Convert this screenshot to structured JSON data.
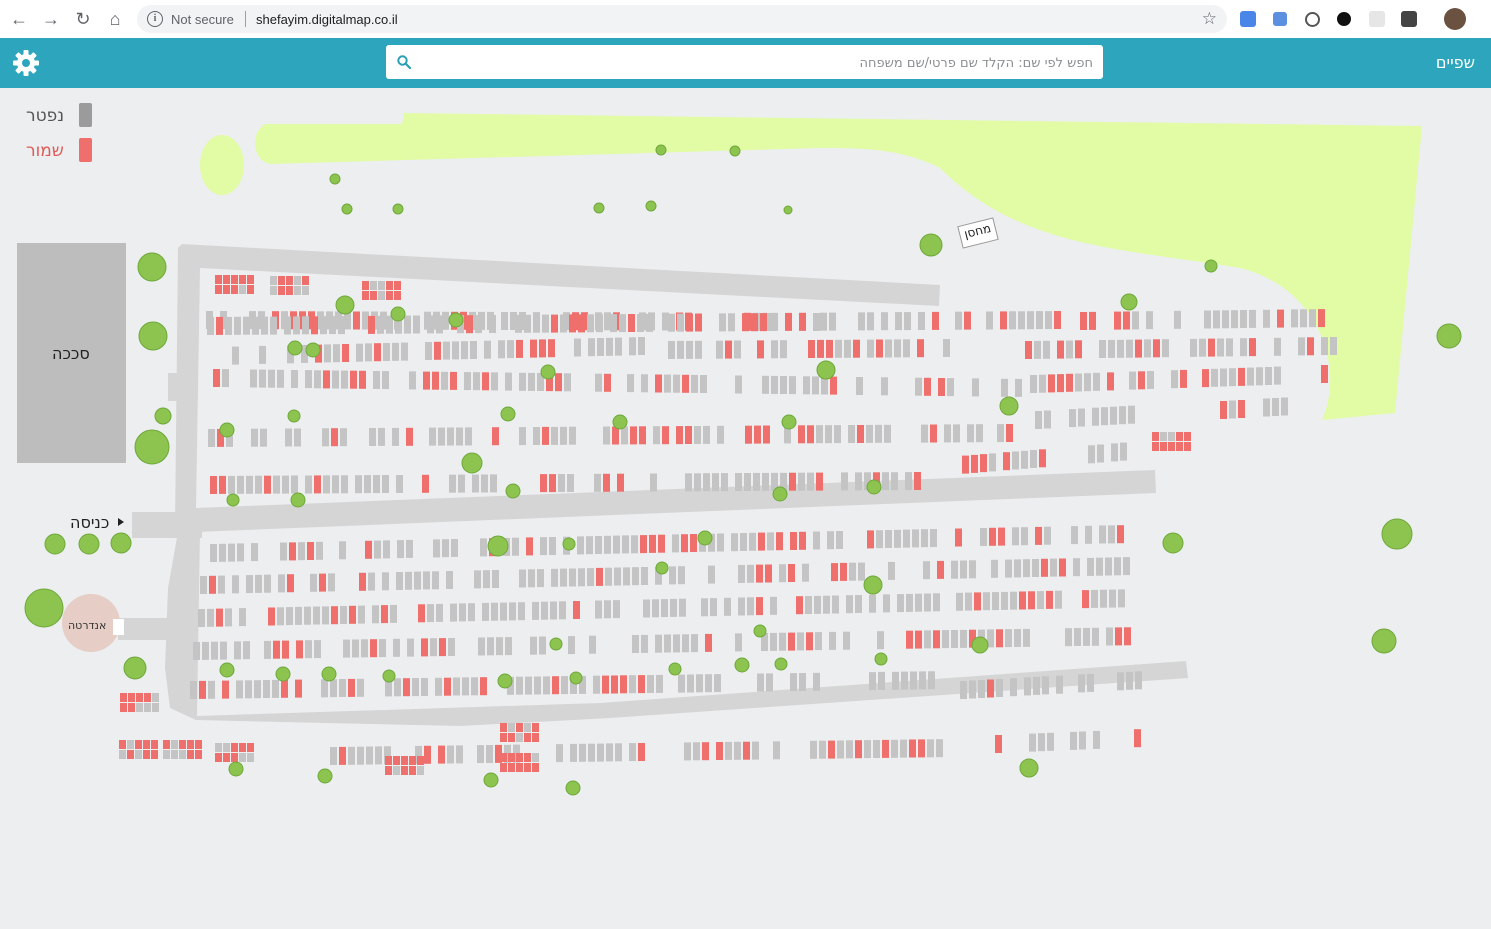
{
  "browser": {
    "security_label": "Not secure",
    "url": "shefayim.digitalmap.co.il"
  },
  "header": {
    "brand": "שפיים",
    "search_placeholder": "חפש לפי שם: הקלד שם פרטי/שם משפחה"
  },
  "legend": {
    "deceased_label": "נפטר",
    "deceased_color": "#9b9b9b",
    "reserved_label": "שמור",
    "reserved_color": "#ef6f6c"
  },
  "map": {
    "labels": {
      "parking": "סככה",
      "entrance": "כניסה",
      "memorial": "אנדרטה",
      "warehouse": "מחסן"
    },
    "colors": {
      "grass": "#e2fca5",
      "path": "#d3d3d3",
      "plot_gray": "#c4c4c4",
      "plot_red": "#ef6f6c",
      "tree": "#8cc44f",
      "parking": "#bdbdbd",
      "memorial": "#e6cdc6",
      "background": "#eceef0"
    }
  }
}
